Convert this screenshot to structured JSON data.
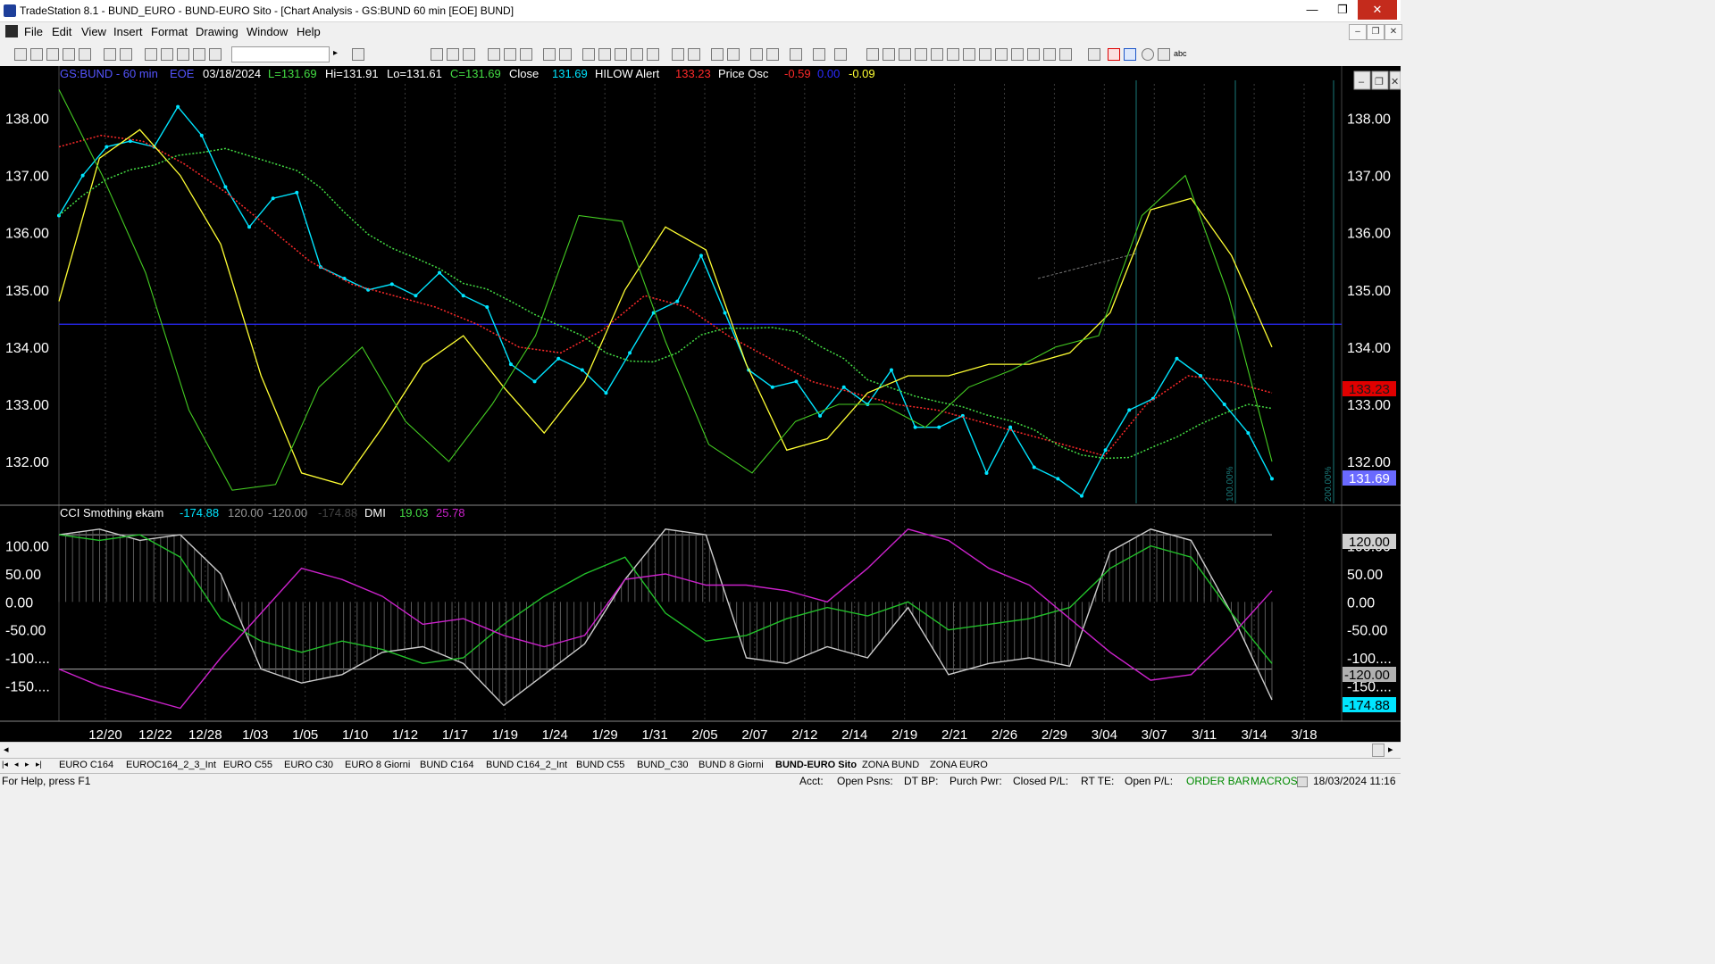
{
  "window": {
    "title": "TradeStation 8.1 - BUND_EURO - BUND-EURO Sito - [Chart Analysis - GS:BUND  60 min  [EOE] BUND]",
    "minimize": "—",
    "maximize": "❐",
    "close": "✕"
  },
  "menu": [
    "File",
    "Edit",
    "View",
    "Insert",
    "Format",
    "Drawing",
    "Window",
    "Help"
  ],
  "header": {
    "symbol": "GS:BUND - 60 min",
    "exchange": "EOE",
    "date": "03/18/2024",
    "last": "L=131.69",
    "high": "Hi=131.91",
    "low": "Lo=131.61",
    "close": "C=131.69",
    "close_label": "Close",
    "close_value": "131.69",
    "hilow_label": "HILOW Alert",
    "hilow_value": "133.23",
    "osc_label": "Price Osc",
    "osc_v1": "-0.59",
    "osc_v2": "0.00",
    "osc_v3": "-0.09"
  },
  "subheader": {
    "cci_label": "CCI Smothing ekam",
    "cci_v1": "-174.88",
    "cci_v2": "120.00",
    "cci_v3": "-120.00",
    "cci_v4": "-174.88",
    "dmi_label": "DMI",
    "dmi_v1": "19.03",
    "dmi_v2": "25.78"
  },
  "chart_data": [
    {
      "type": "line",
      "title": "GS:BUND - 60 min",
      "ylim": [
        131.3,
        138.6
      ],
      "y_ticks": [
        "138.00",
        "137.00",
        "136.00",
        "135.00",
        "134.00",
        "133.00",
        "132.00"
      ],
      "x_ticks": [
        "12/20",
        "12/22",
        "12/28",
        "1/03",
        "1/05",
        "1/10",
        "1/12",
        "1/17",
        "1/19",
        "1/24",
        "1/29",
        "1/31",
        "2/05",
        "2/07",
        "2/12",
        "2/14",
        "2/19",
        "2/21",
        "2/26",
        "2/29",
        "3/04",
        "3/07",
        "3/11",
        "3/14",
        "3/18"
      ],
      "horizontal_line": 134.4,
      "price_labels": {
        "hilow": "133.23",
        "last": "131.69"
      },
      "series": [
        {
          "name": "Close",
          "color": "#00e5ff",
          "values": [
            136.3,
            137.0,
            137.5,
            137.6,
            137.5,
            138.2,
            137.7,
            136.8,
            136.1,
            136.6,
            136.7,
            135.4,
            135.2,
            135.0,
            135.1,
            134.9,
            135.3,
            134.9,
            134.7,
            133.7,
            133.4,
            133.8,
            133.6,
            133.2,
            133.9,
            134.6,
            134.8,
            135.6,
            134.6,
            133.6,
            133.3,
            133.4,
            132.8,
            133.3,
            133.0,
            133.6,
            132.6,
            132.6,
            132.8,
            131.8,
            132.6,
            131.9,
            131.7,
            131.4,
            132.2,
            132.9,
            133.1,
            133.8,
            133.5,
            133.0,
            132.5,
            131.7
          ]
        },
        {
          "name": "HILOW Alert",
          "color": "#ff2a2a",
          "values": [
            137.5,
            137.7,
            137.6,
            137.2,
            136.7,
            136.1,
            135.5,
            135.1,
            134.9,
            134.7,
            134.4,
            134.0,
            133.9,
            134.3,
            134.9,
            134.7,
            134.2,
            133.8,
            133.4,
            133.2,
            133.0,
            132.9,
            132.7,
            132.5,
            132.3,
            132.1,
            133.0,
            133.5,
            133.4,
            133.2
          ]
        },
        {
          "name": "Price Osc",
          "color": "#ffff33",
          "values": [
            134.8,
            137.3,
            137.8,
            137.0,
            135.8,
            133.5,
            131.8,
            131.6,
            132.6,
            133.7,
            134.2,
            133.3,
            132.5,
            133.4,
            135.0,
            136.1,
            135.7,
            133.7,
            132.2,
            132.4,
            133.2,
            133.5,
            133.5,
            133.7,
            133.7,
            133.9,
            134.6,
            136.4,
            136.6,
            135.6,
            134.0
          ]
        },
        {
          "name": "Price Osc 2",
          "color": "#44cc22",
          "values": [
            138.5,
            137.0,
            135.3,
            132.9,
            131.5,
            131.6,
            133.3,
            134.0,
            132.7,
            132.0,
            133.0,
            134.2,
            136.3,
            136.2,
            134.1,
            132.3,
            131.8,
            132.7,
            133.0,
            133.0,
            132.6,
            133.3,
            133.6,
            134.0,
            134.2,
            136.3,
            137.0,
            134.9,
            132.0
          ]
        }
      ]
    },
    {
      "type": "line",
      "title": "CCI Smothing ekam",
      "ylim": [
        -210,
        160
      ],
      "y_ticks": [
        "100.00",
        "50.00",
        "0.00",
        "-50.00",
        "-100....",
        "-150...."
      ],
      "levels": {
        "upper": 120,
        "lower": -120
      },
      "level_labels": {
        "upper": "120.00",
        "lower": "-120.00",
        "last": "-174.88"
      },
      "series": [
        {
          "name": "CCI",
          "color": "#cccccc",
          "values": [
            120,
            130,
            110,
            120,
            50,
            -120,
            -145,
            -130,
            -90,
            -80,
            -110,
            -185,
            -130,
            -75,
            40,
            130,
            120,
            -100,
            -110,
            -80,
            -100,
            -10,
            -130,
            -110,
            -100,
            -115,
            90,
            130,
            110,
            -20,
            -175
          ]
        },
        {
          "name": "DMI+",
          "color": "#22c02a",
          "values": [
            120,
            110,
            120,
            80,
            -30,
            -70,
            -90,
            -70,
            -85,
            -110,
            -100,
            -40,
            10,
            50,
            80,
            -20,
            -70,
            -60,
            -30,
            -10,
            -25,
            0,
            -50,
            -40,
            -30,
            -10,
            60,
            100,
            80,
            -20,
            -110
          ]
        },
        {
          "name": "DMI-",
          "color": "#cc22cc",
          "values": [
            -120,
            -150,
            -170,
            -190,
            -100,
            -20,
            60,
            40,
            10,
            -40,
            -30,
            -60,
            -80,
            -60,
            40,
            50,
            30,
            30,
            20,
            0,
            60,
            130,
            110,
            60,
            30,
            -30,
            -90,
            -140,
            -130,
            -60,
            20
          ]
        }
      ]
    }
  ],
  "chart_window_buttons": [
    "–",
    "❐",
    "✕"
  ],
  "percent_labels": [
    "100.00%",
    "200.00%"
  ],
  "sheet_tabs": [
    "EURO C164",
    "EUROC164_2_3_Int",
    "EURO C55",
    "EURO C30",
    "EURO 8 Giorni",
    "BUND C164",
    "BUND C164_2_Int",
    "BUND C55",
    "BUND_C30",
    "BUND 8 Giorni",
    "BUND-EURO Sito",
    "ZONA BUND",
    "ZONA EURO"
  ],
  "active_tab": "BUND-EURO Sito",
  "status": {
    "help": "For Help, press F1",
    "acct": "Acct:",
    "open_psns": "Open Psns:",
    "dt_bp": "DT BP:",
    "purch_pwr": "Purch Pwr:",
    "closed_pl": "Closed P/L:",
    "rt_te": "RT TE:",
    "open_pl": "Open P/L:",
    "order_bar": "ORDER BAR",
    "macros": "MACROS",
    "datetime": "18/03/2024 11:16"
  },
  "colors": {
    "background": "#000000",
    "close": "#00e5ff",
    "hilow": "#ff2a2a",
    "osc_fast": "#ffff33",
    "osc_slow": "#44cc22",
    "cci": "#cccccc",
    "dmi_minus": "#cc22cc",
    "hline": "#2a2aff"
  }
}
